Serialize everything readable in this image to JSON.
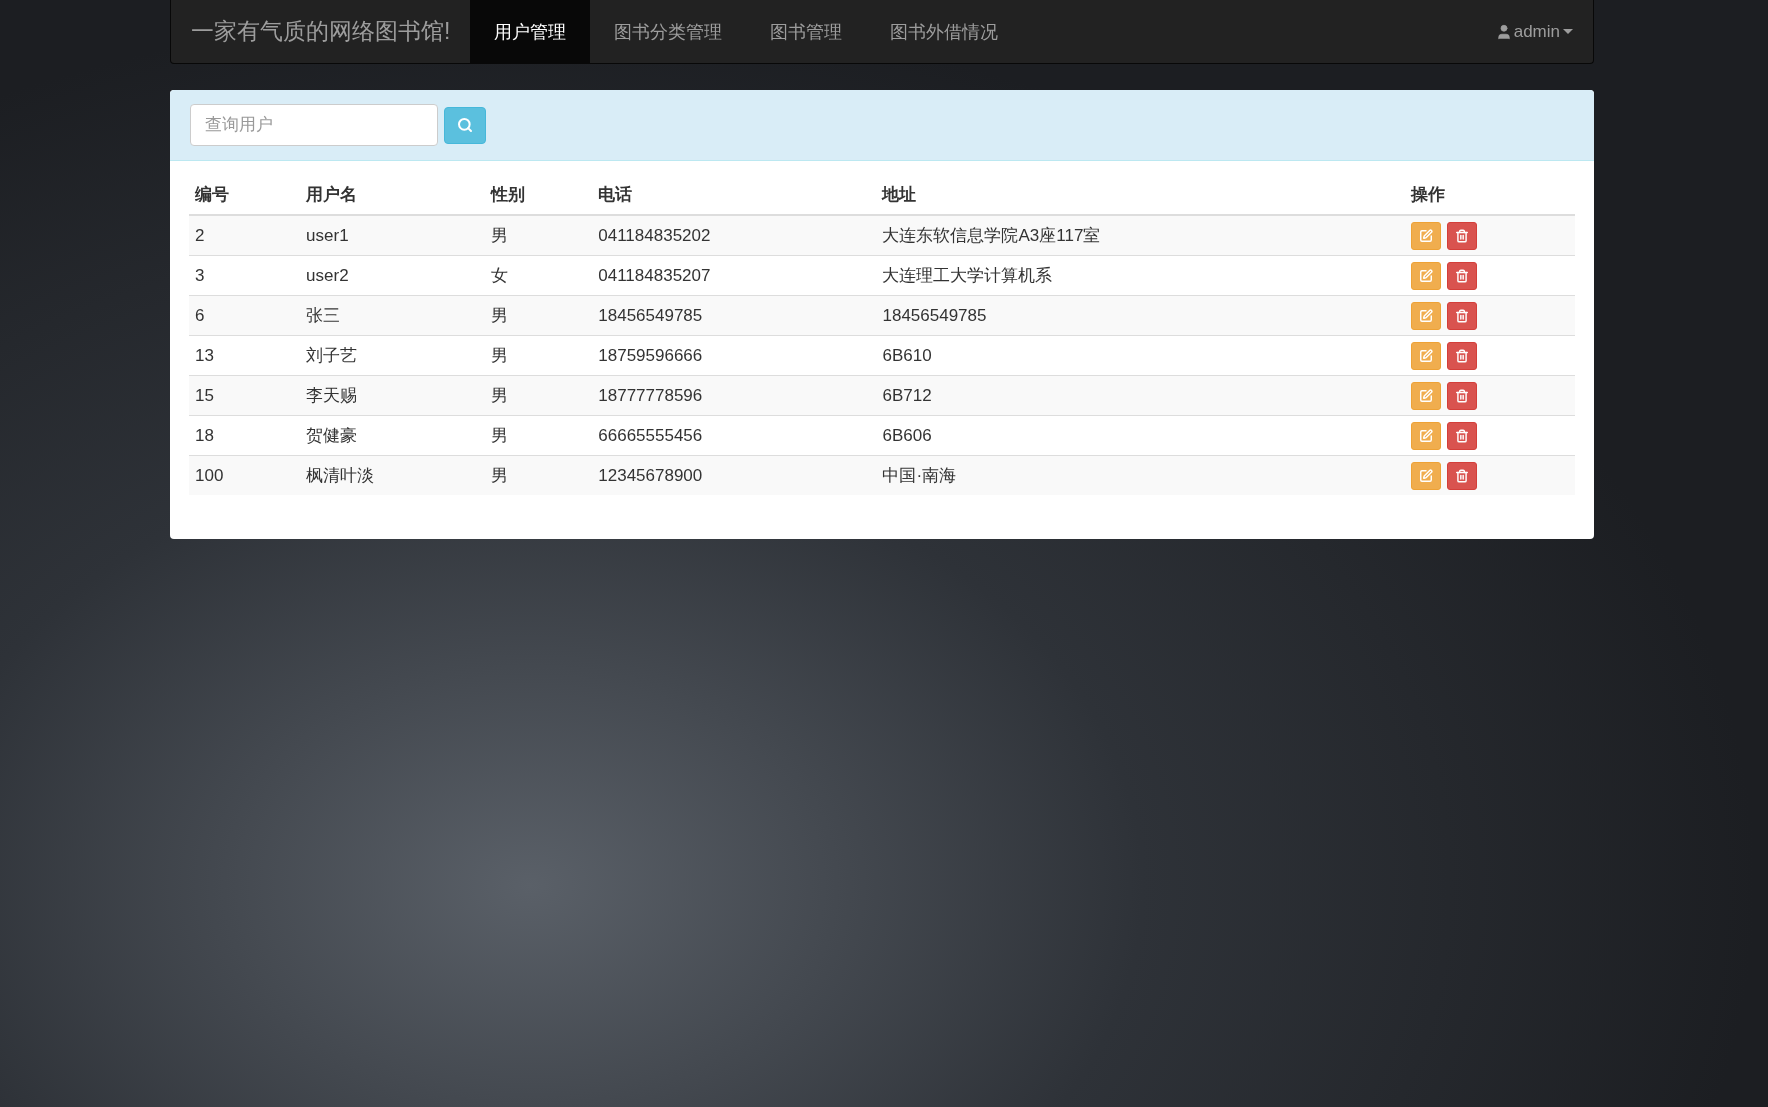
{
  "navbar": {
    "brand": "一家有气质的网络图书馆!",
    "tabs": [
      {
        "label": "用户管理",
        "selected": true
      },
      {
        "label": "图书分类管理",
        "selected": false
      },
      {
        "label": "图书管理",
        "selected": false
      },
      {
        "label": "图书外借情况",
        "selected": false
      }
    ],
    "user": "admin"
  },
  "search": {
    "placeholder": "查询用户"
  },
  "table": {
    "columns": [
      "编号",
      "用户名",
      "性别",
      "电话",
      "地址",
      "操作"
    ],
    "rows": [
      {
        "cells": [
          "2",
          "user1",
          "男",
          "041184835202",
          "大连东软信息学院A3座117室"
        ]
      },
      {
        "cells": [
          "3",
          "user2",
          "女",
          "041184835207",
          "大连理工大学计算机系"
        ]
      },
      {
        "cells": [
          "6",
          "张三",
          "男",
          "18456549785",
          "18456549785"
        ]
      },
      {
        "cells": [
          "13",
          "刘子艺",
          "男",
          "18759596666",
          "6B610"
        ]
      },
      {
        "cells": [
          "15",
          "李天赐",
          "男",
          "18777778596",
          "6B712"
        ]
      },
      {
        "cells": [
          "18",
          "贺健豪",
          "男",
          "66665555456",
          "6B606"
        ]
      },
      {
        "cells": [
          "100",
          "枫清叶淡",
          "男",
          "12345678900",
          "中国·南海"
        ]
      }
    ]
  }
}
